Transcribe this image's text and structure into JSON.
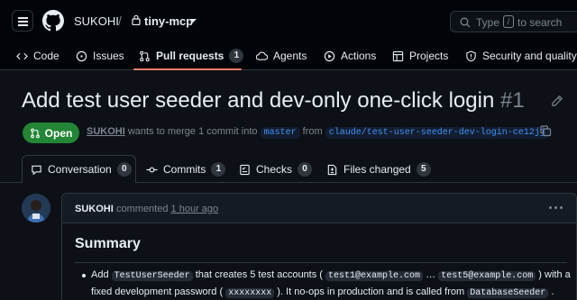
{
  "header": {
    "owner": "SUKOHI",
    "separator": "/",
    "repo": "tiny-mcp",
    "search": {
      "prefix": "Type",
      "key": "/",
      "suffix": "to search"
    }
  },
  "nav": [
    {
      "label": "Code",
      "icon": "code-icon"
    },
    {
      "label": "Issues",
      "icon": "issue-icon"
    },
    {
      "label": "Pull requests",
      "icon": "pull-request-icon",
      "count": "1",
      "active": true
    },
    {
      "label": "Agents",
      "icon": "agents-icon"
    },
    {
      "label": "Actions",
      "icon": "play-icon"
    },
    {
      "label": "Projects",
      "icon": "table-icon"
    },
    {
      "label": "Security and quality",
      "icon": "shield-icon"
    }
  ],
  "pr": {
    "title": "Add test user seeder and dev-only one-click login",
    "number": "#1",
    "state": "Open",
    "author": "SUKOHI",
    "meta_text": "wants to merge 1 commit into",
    "base_branch": "master",
    "from_text": "from",
    "head_branch": "claude/test-user-seeder-dev-login-ce12jj"
  },
  "tabs": [
    {
      "label": "Conversation",
      "count": "0",
      "icon": "comment-icon"
    },
    {
      "label": "Commits",
      "count": "1",
      "icon": "commit-icon"
    },
    {
      "label": "Checks",
      "count": "0",
      "icon": "checklist-icon"
    },
    {
      "label": "Files changed",
      "count": "5",
      "icon": "file-diff-icon"
    }
  ],
  "comment": {
    "author": "SUKOHI",
    "action": "commented",
    "time": "1 hour ago",
    "heading": "Summary",
    "line1": {
      "t1": "Add",
      "c1": "TestUserSeeder",
      "t2": "that creates 5 test accounts (",
      "c2": "test1@example.com",
      "t3": "…",
      "c3": "test5@example.com",
      "t4": ") with a"
    },
    "line2": {
      "t1": "fixed development password (",
      "c1": "xxxxxxxx",
      "t2": "). It no-ops in production and is called from",
      "c2": "DatabaseSeeder",
      "t3": "."
    }
  },
  "colors": {
    "background": "#0d1117",
    "header_bg": "#010409",
    "border": "#30363d",
    "open_green": "#238636",
    "link_blue": "#4493f8",
    "active_underline": "#f78166",
    "muted": "#7d8590"
  }
}
